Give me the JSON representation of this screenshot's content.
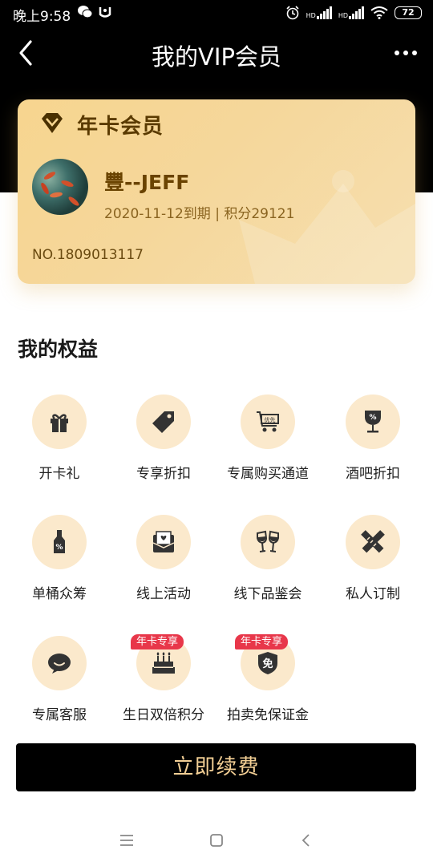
{
  "status_bar": {
    "time": "晚上9:58",
    "battery": "72",
    "hd_label": "HD",
    "icons": [
      "wechat-icon",
      "notification-icon",
      "alarm-icon",
      "signal-icon",
      "signal-icon",
      "wifi-icon",
      "battery-icon"
    ]
  },
  "header": {
    "title": "我的VIP会员"
  },
  "card": {
    "type": "年卡会员",
    "user_name": "豐--JEFF",
    "meta": "2020-11-12到期 | 积分29121",
    "number": "NO.1809013117"
  },
  "benefits": {
    "title": "我的权益",
    "items": [
      {
        "label": "开卡礼",
        "icon": "gift-icon"
      },
      {
        "label": "专享折扣",
        "icon": "tag-icon"
      },
      {
        "label": "专属购买通道",
        "icon": "cart-icon"
      },
      {
        "label": "酒吧折扣",
        "icon": "wine-glass-icon"
      },
      {
        "label": "单桶众筹",
        "icon": "bottle-icon"
      },
      {
        "label": "线上活动",
        "icon": "mail-heart-icon"
      },
      {
        "label": "线下品鉴会",
        "icon": "cheers-icon"
      },
      {
        "label": "私人订制",
        "icon": "pencil-ruler-icon"
      },
      {
        "label": "专属客服",
        "icon": "chat-icon"
      },
      {
        "label": "生日双倍积分",
        "icon": "cake-icon",
        "badge": "年卡专享"
      },
      {
        "label": "拍卖免保证金",
        "icon": "shield-free-icon",
        "badge": "年卡专享"
      }
    ],
    "cart_icon_text": "优先",
    "percent_text": "%",
    "free_text": "免"
  },
  "renew_button": "立即续费",
  "colors": {
    "accent_gold": "#f3cf95",
    "icon_dark": "#333333",
    "circle_bg": "#fbe9cc",
    "badge_red": "#e8374a"
  }
}
